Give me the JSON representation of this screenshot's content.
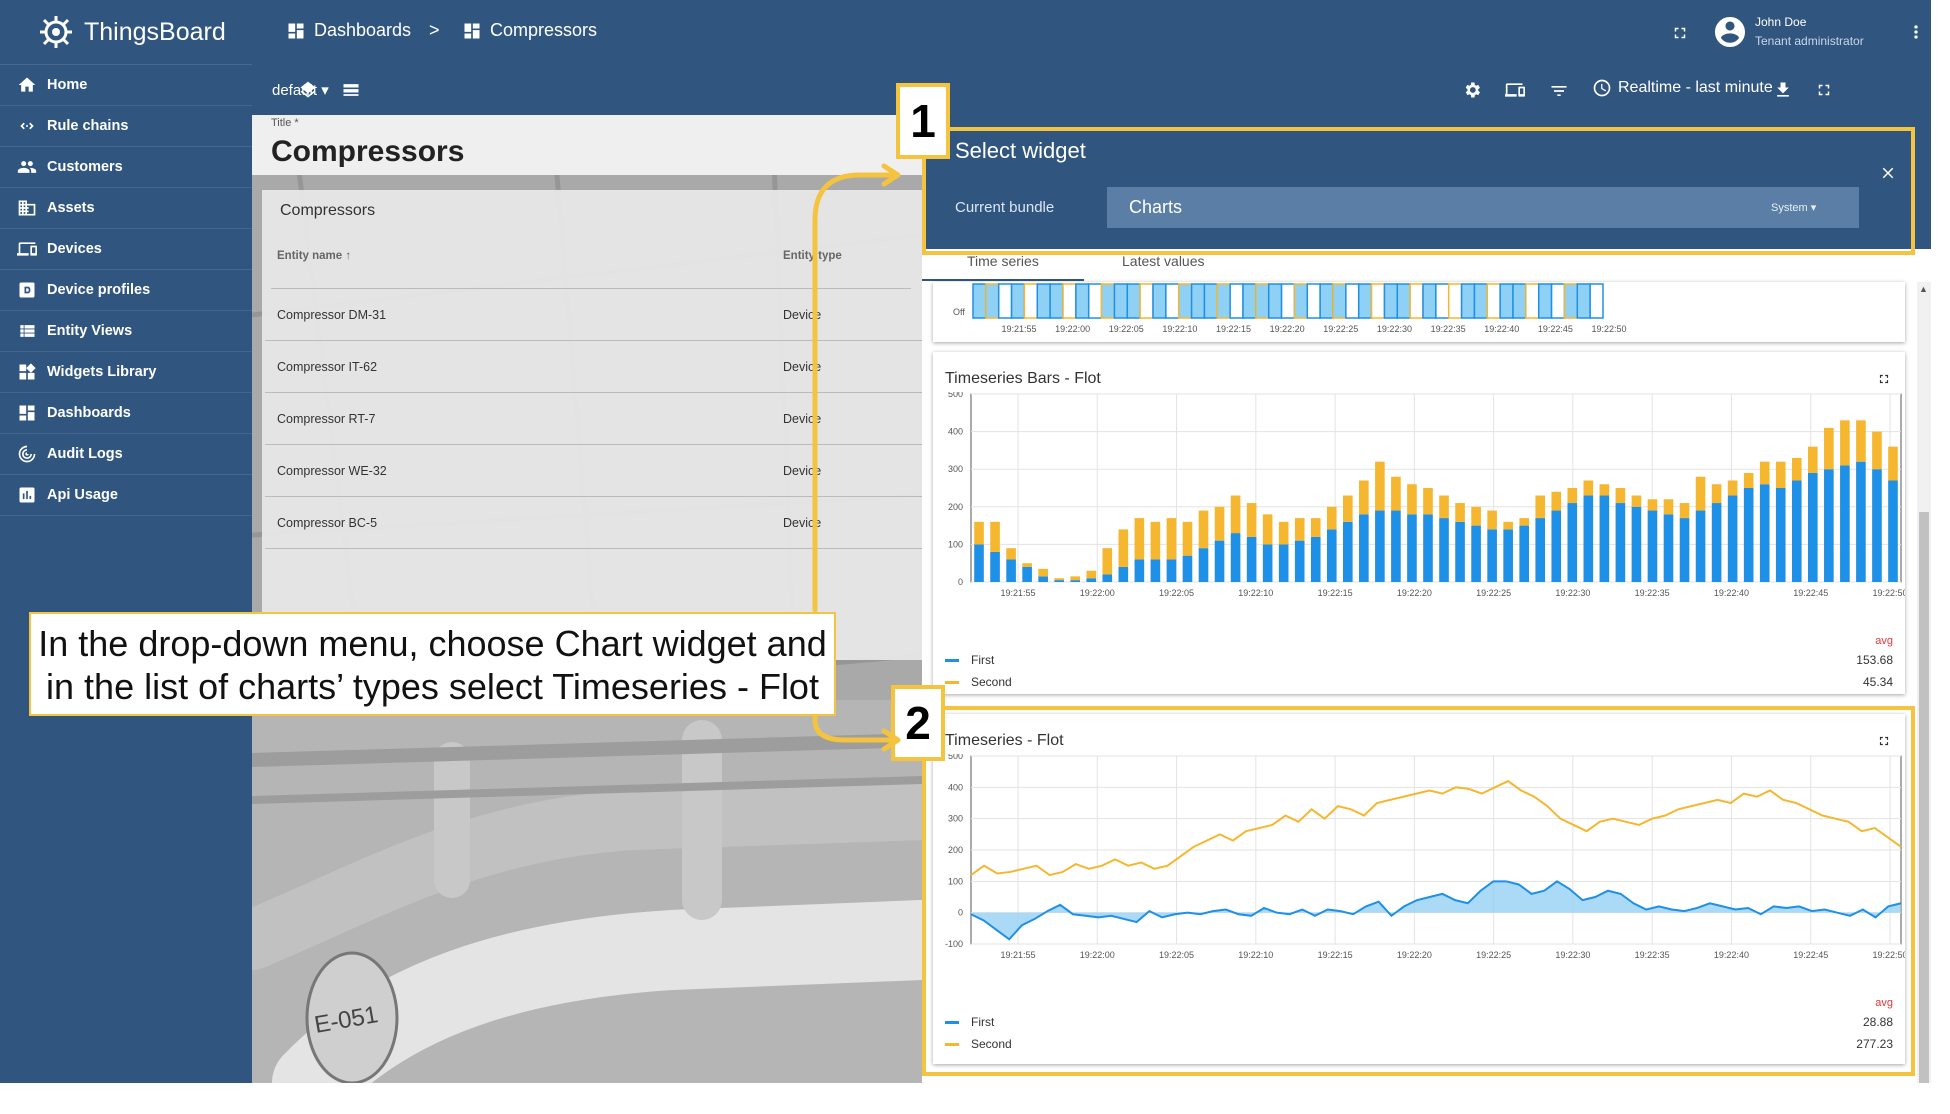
{
  "app": {
    "name": "ThingsBoard"
  },
  "breadcrumb": {
    "items": [
      "Dashboards",
      "Compressors"
    ],
    "separator": ">"
  },
  "user": {
    "name": "John Doe",
    "role": "Tenant administrator"
  },
  "sidebar": {
    "items": [
      {
        "label": "Home",
        "icon": "home-icon"
      },
      {
        "label": "Rule chains",
        "icon": "rule-chains-icon"
      },
      {
        "label": "Customers",
        "icon": "customers-icon"
      },
      {
        "label": "Assets",
        "icon": "assets-icon"
      },
      {
        "label": "Devices",
        "icon": "devices-icon"
      },
      {
        "label": "Device profiles",
        "icon": "device-profiles-icon"
      },
      {
        "label": "Entity Views",
        "icon": "entity-views-icon"
      },
      {
        "label": "Widgets Library",
        "icon": "widgets-library-icon"
      },
      {
        "label": "Dashboards",
        "icon": "dashboards-icon"
      },
      {
        "label": "Audit Logs",
        "icon": "audit-logs-icon"
      },
      {
        "label": "Api Usage",
        "icon": "api-usage-icon"
      }
    ]
  },
  "toolbar": {
    "state": "default",
    "timewindow": "Realtime - last minute"
  },
  "dashboard": {
    "title_label": "Title *",
    "title": "Compressors"
  },
  "entities_table": {
    "title": "Compressors",
    "columns": [
      "Entity name",
      "Entity type"
    ],
    "rows": [
      [
        "Compressor DM-31",
        "Device"
      ],
      [
        "Compressor IT-62",
        "Device"
      ],
      [
        "Compressor RT-7",
        "Device"
      ],
      [
        "Compressor WE-32",
        "Device"
      ],
      [
        "Compressor BC-5",
        "Device"
      ]
    ]
  },
  "select_widget": {
    "title": "Select widget",
    "bundle_label": "Current bundle",
    "bundle_value": "Charts",
    "bundle_scope": "System",
    "tabs": [
      "Time series",
      "Latest values"
    ]
  },
  "annotations": {
    "step1": "1",
    "step2": "2",
    "callout_line1": "In the drop-down menu, choose Chart widget and",
    "callout_line2": "in the list of charts’ types select Timeseries - Flot"
  },
  "colors": {
    "primary": "#305680",
    "first": "#1e90e6",
    "second": "#f5b72f",
    "highlight": "#f4c33f"
  },
  "chart_data": [
    {
      "type": "state",
      "title": "",
      "series": [
        {
          "name": "",
          "values": [
            1,
            1,
            0,
            1,
            0,
            1,
            1,
            0,
            1,
            0,
            1,
            1,
            1,
            0,
            1,
            0,
            1,
            1,
            1,
            1,
            0,
            1,
            1,
            1,
            0,
            1,
            0,
            1,
            1,
            0,
            1,
            0,
            1,
            1,
            0,
            1,
            0,
            0,
            1,
            1,
            0,
            1,
            1,
            0,
            1,
            0,
            1,
            1,
            0
          ]
        }
      ],
      "ylabel_bottom": "Off",
      "x_ticks": [
        "19:21:55",
        "19:22:00",
        "19:22:05",
        "19:22:10",
        "19:22:15",
        "19:22:20",
        "19:22:25",
        "19:22:30",
        "19:22:35",
        "19:22:40",
        "19:22:45",
        "19:22:50"
      ]
    },
    {
      "type": "bar",
      "title": "Timeseries Bars - Flot",
      "ylim": [
        0,
        500
      ],
      "y_ticks": [
        "500",
        "400",
        "300",
        "200",
        "100",
        "0"
      ],
      "x_ticks": [
        "19:21:55",
        "19:22:00",
        "19:22:05",
        "19:22:10",
        "19:22:15",
        "19:22:20",
        "19:22:25",
        "19:22:30",
        "19:22:35",
        "19:22:40",
        "19:22:45",
        "19:22:50"
      ],
      "series": [
        {
          "name": "First",
          "avg": "153.68",
          "values": [
            100,
            80,
            60,
            40,
            15,
            5,
            5,
            10,
            20,
            40,
            60,
            60,
            60,
            70,
            90,
            110,
            130,
            120,
            100,
            100,
            110,
            120,
            140,
            160,
            180,
            190,
            190,
            180,
            180,
            170,
            160,
            150,
            140,
            140,
            150,
            170,
            190,
            210,
            230,
            230,
            210,
            200,
            190,
            180,
            170,
            190,
            210,
            230,
            250,
            260,
            250,
            270,
            290,
            300,
            310,
            320,
            300,
            270
          ]
        },
        {
          "name": "Second",
          "avg": "45.34",
          "values": [
            60,
            80,
            30,
            10,
            20,
            5,
            10,
            20,
            70,
            100,
            110,
            100,
            110,
            90,
            100,
            90,
            100,
            90,
            80,
            60,
            60,
            50,
            60,
            70,
            90,
            130,
            90,
            80,
            70,
            60,
            50,
            50,
            50,
            20,
            20,
            60,
            50,
            40,
            40,
            30,
            40,
            30,
            30,
            40,
            40,
            90,
            50,
            40,
            40,
            60,
            70,
            60,
            70,
            110,
            120,
            110,
            100,
            90
          ]
        }
      ]
    },
    {
      "type": "line",
      "title": "Timeseries - Flot",
      "ylim": [
        -100,
        500
      ],
      "y_ticks": [
        "500",
        "400",
        "300",
        "200",
        "100",
        "0",
        "-100"
      ],
      "x_ticks": [
        "19:21:55",
        "19:22:00",
        "19:22:05",
        "19:22:10",
        "19:22:15",
        "19:22:20",
        "19:22:25",
        "19:22:30",
        "19:22:35",
        "19:22:40",
        "19:22:45",
        "19:22:50"
      ],
      "series": [
        {
          "name": "First",
          "avg": "28.88",
          "fill": true,
          "values": [
            -5,
            -25,
            -55,
            -85,
            -40,
            -20,
            5,
            25,
            -5,
            -10,
            -15,
            -10,
            -20,
            -30,
            5,
            -15,
            -5,
            0,
            -5,
            5,
            10,
            -5,
            -10,
            15,
            0,
            -5,
            10,
            -10,
            10,
            5,
            -5,
            20,
            35,
            -10,
            20,
            40,
            50,
            60,
            40,
            30,
            70,
            100,
            100,
            90,
            60,
            70,
            100,
            75,
            40,
            50,
            70,
            60,
            30,
            10,
            20,
            10,
            5,
            15,
            30,
            20,
            10,
            15,
            -5,
            20,
            15,
            20,
            5,
            10,
            0,
            -10,
            10,
            -15,
            20,
            30
          ]
        },
        {
          "name": "Second",
          "avg": "277.23",
          "values": [
            120,
            150,
            125,
            130,
            140,
            150,
            120,
            130,
            155,
            140,
            150,
            170,
            150,
            160,
            140,
            150,
            180,
            210,
            230,
            250,
            230,
            260,
            270,
            280,
            310,
            290,
            330,
            300,
            340,
            330,
            310,
            350,
            360,
            370,
            380,
            390,
            380,
            400,
            395,
            380,
            400,
            420,
            390,
            370,
            340,
            300,
            280,
            260,
            290,
            300,
            290,
            280,
            300,
            310,
            330,
            340,
            350,
            360,
            350,
            380,
            370,
            390,
            360,
            350,
            330,
            310,
            300,
            290,
            260,
            270,
            240,
            210
          ]
        }
      ]
    }
  ]
}
